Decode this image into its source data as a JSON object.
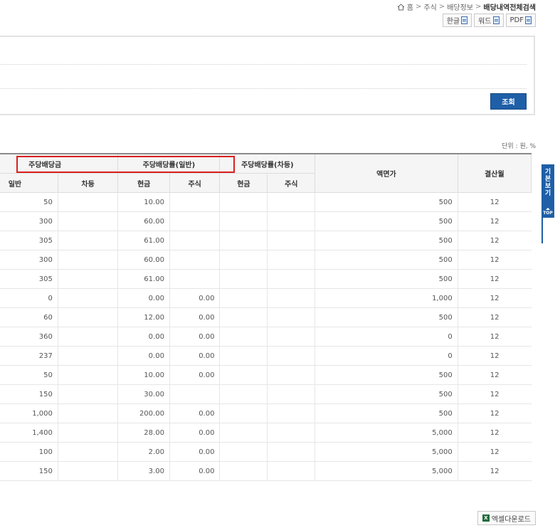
{
  "breadcrumb": {
    "home": "홈",
    "items": [
      "주식",
      "배당정보"
    ],
    "current": "배당내역전체검색",
    "separator": ">"
  },
  "export": {
    "hangul": "한글",
    "word": "워드",
    "pdf": "PDF"
  },
  "search": {
    "button": "조회"
  },
  "unit": "단위 : 원, %",
  "table": {
    "group_headers": {
      "per_share_dividend": "주당배당금",
      "div_rate_general": "주당배당률(일반)",
      "div_rate_diff": "주당배당률(차등)",
      "par_value": "액면가",
      "settle_month": "결산월"
    },
    "sub_headers": {
      "general": "일반",
      "diff": "차등",
      "cash_1": "현금",
      "stock_1": "주식",
      "cash_2": "현금",
      "stock_2": "주식"
    },
    "rows": [
      [
        "50",
        "",
        "10.00",
        "",
        "",
        "",
        "500",
        "12"
      ],
      [
        "300",
        "",
        "60.00",
        "",
        "",
        "",
        "500",
        "12"
      ],
      [
        "305",
        "",
        "61.00",
        "",
        "",
        "",
        "500",
        "12"
      ],
      [
        "300",
        "",
        "60.00",
        "",
        "",
        "",
        "500",
        "12"
      ],
      [
        "305",
        "",
        "61.00",
        "",
        "",
        "",
        "500",
        "12"
      ],
      [
        "0",
        "",
        "0.00",
        "0.00",
        "",
        "",
        "1,000",
        "12"
      ],
      [
        "60",
        "",
        "12.00",
        "0.00",
        "",
        "",
        "500",
        "12"
      ],
      [
        "360",
        "",
        "0.00",
        "0.00",
        "",
        "",
        "0",
        "12"
      ],
      [
        "237",
        "",
        "0.00",
        "0.00",
        "",
        "",
        "0",
        "12"
      ],
      [
        "50",
        "",
        "10.00",
        "0.00",
        "",
        "",
        "500",
        "12"
      ],
      [
        "150",
        "",
        "30.00",
        "",
        "",
        "",
        "500",
        "12"
      ],
      [
        "1,000",
        "",
        "200.00",
        "0.00",
        "",
        "",
        "500",
        "12"
      ],
      [
        "1,400",
        "",
        "28.00",
        "0.00",
        "",
        "",
        "5,000",
        "12"
      ],
      [
        "100",
        "",
        "2.00",
        "0.00",
        "",
        "",
        "5,000",
        "12"
      ],
      [
        "150",
        "",
        "3.00",
        "0.00",
        "",
        "",
        "5,000",
        "12"
      ]
    ]
  },
  "side_tab": {
    "label": "기본보기",
    "top": "TOP"
  },
  "excel": {
    "label": "엑셀다운로드"
  },
  "colors": {
    "accent": "#1e5fa8",
    "highlight": "#d9201f"
  }
}
